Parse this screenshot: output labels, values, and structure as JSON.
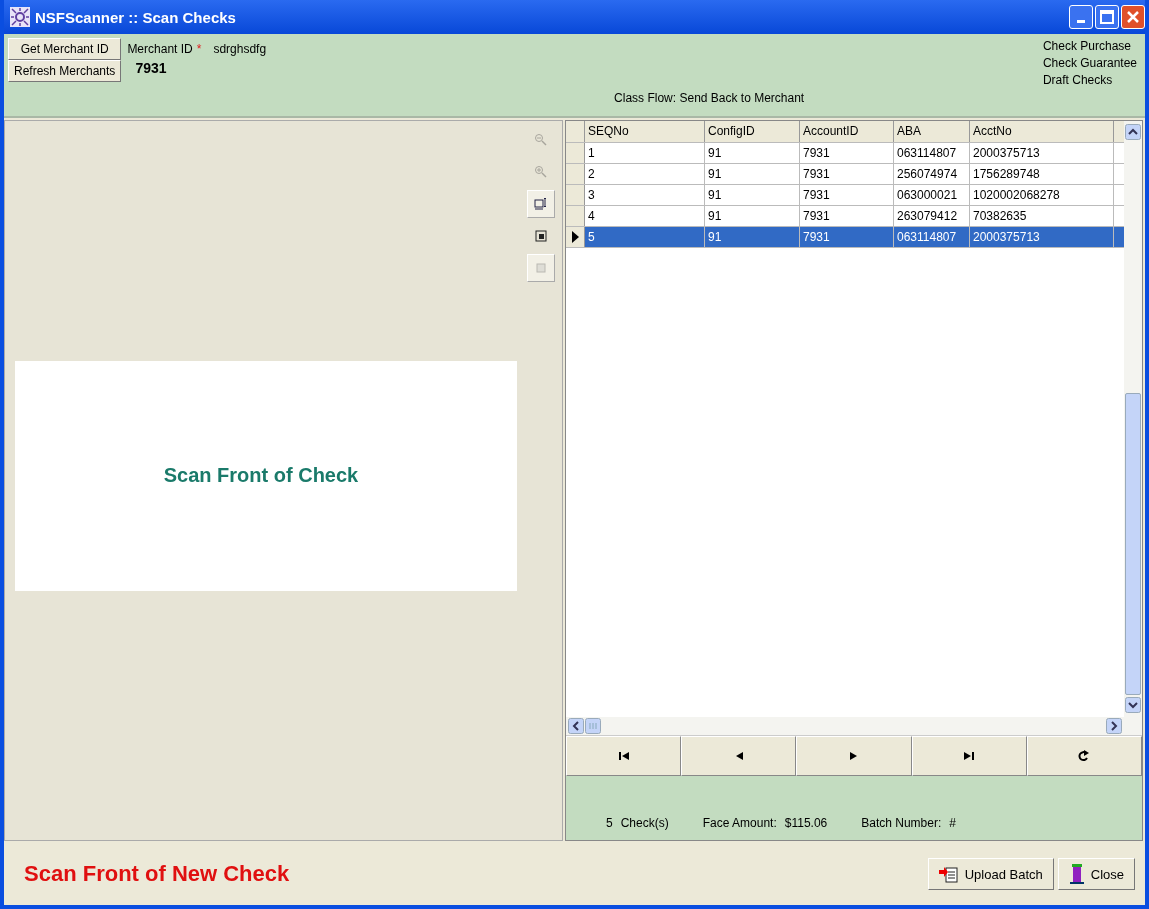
{
  "window": {
    "title": "NSFScanner :: Scan Checks"
  },
  "toolbar": {
    "buttons": [
      "Get Merchant ID",
      "Refresh Merchants"
    ],
    "merchant_label": "Merchant ID",
    "required_mark": "*",
    "merchant_name": "sdrghsdfg",
    "merchant_id": "7931",
    "class_flow": "Class Flow: Send Back to Merchant",
    "check_types": [
      "Check Purchase",
      "Check Guarantee",
      "Draft Checks"
    ]
  },
  "image_panel": {
    "caption": "Scan Front of Check"
  },
  "image_tools": [
    {
      "kind": "zoom-out",
      "disabled": true,
      "pressed": false
    },
    {
      "kind": "zoom-in",
      "disabled": true,
      "pressed": false
    },
    {
      "kind": "fit",
      "disabled": false,
      "pressed": true
    },
    {
      "kind": "actual",
      "disabled": false,
      "pressed": false
    },
    {
      "kind": "page",
      "disabled": true,
      "pressed": true
    }
  ],
  "table": {
    "columns": [
      "SEQNo",
      "ConfigID",
      "AccountID",
      "ABA",
      "AcctNo"
    ],
    "rows": [
      {
        "cells": [
          "1",
          "91",
          "7931",
          "063114807",
          "2000375713"
        ],
        "selected": false
      },
      {
        "cells": [
          "2",
          "91",
          "7931",
          "256074974",
          "1756289748"
        ],
        "selected": false
      },
      {
        "cells": [
          "3",
          "91",
          "7931",
          "063000021",
          "1020002068278"
        ],
        "selected": false
      },
      {
        "cells": [
          "4",
          "91",
          "7931",
          "263079412",
          "70382635"
        ],
        "selected": false
      },
      {
        "cells": [
          "5",
          "91",
          "7931",
          "063114807",
          "2000375713"
        ],
        "selected": true
      }
    ]
  },
  "summary": {
    "count": "5",
    "count_label": "Check(s)",
    "amount_label": "Face Amount:",
    "amount": "$115.06",
    "batch_label": "Batch Number:",
    "batch": "#"
  },
  "status": "Scan Front of New Check",
  "buttons": [
    "Upload Batch",
    "Close"
  ]
}
